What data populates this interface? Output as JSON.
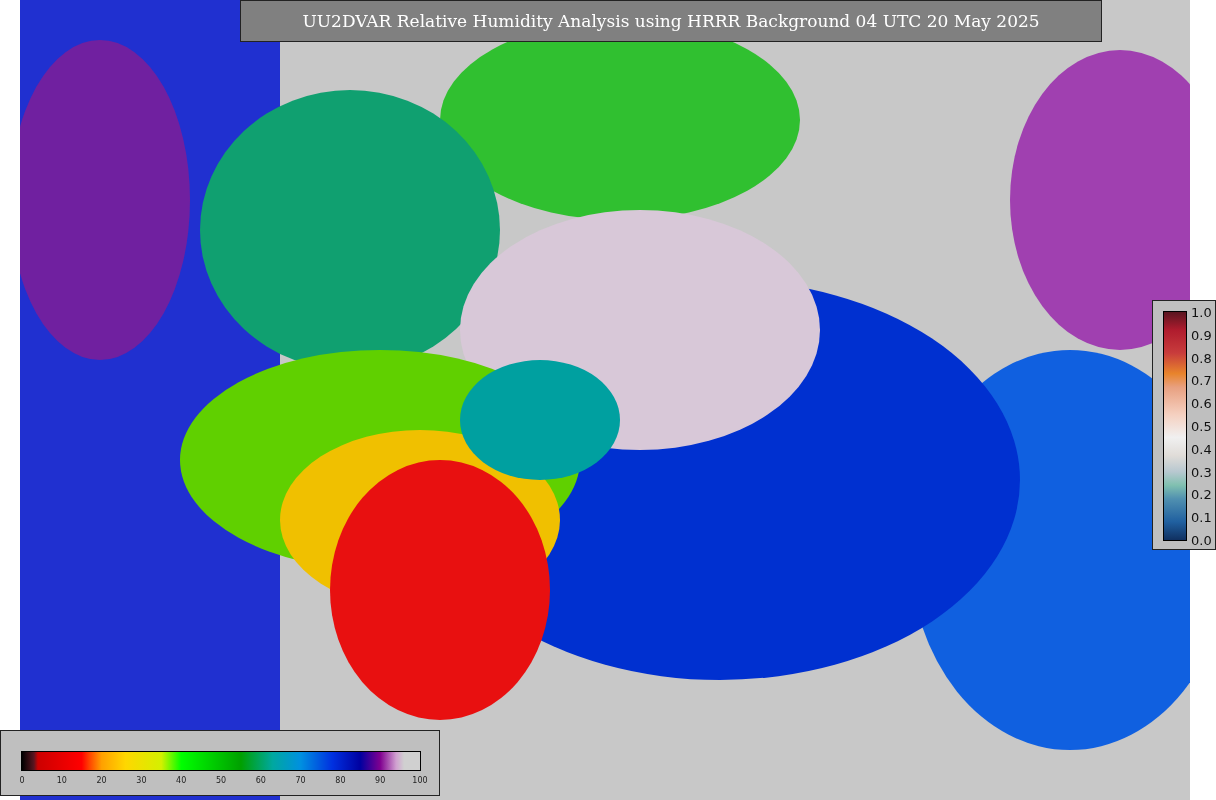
{
  "title": "UU2DVAR Relative Humidity Analysis using HRRR Background 04 UTC 20 May 2025",
  "humidity_colorbar": {
    "ticks": [
      "0",
      "10",
      "20",
      "30",
      "40",
      "50",
      "60",
      "70",
      "80",
      "90",
      "100"
    ]
  },
  "observation_colorbar": {
    "ticks": [
      "1.0",
      "0.9",
      "0.8",
      "0.7",
      "0.6",
      "0.5",
      "0.4",
      "0.3",
      "0.2",
      "0.1",
      "0.0"
    ]
  }
}
